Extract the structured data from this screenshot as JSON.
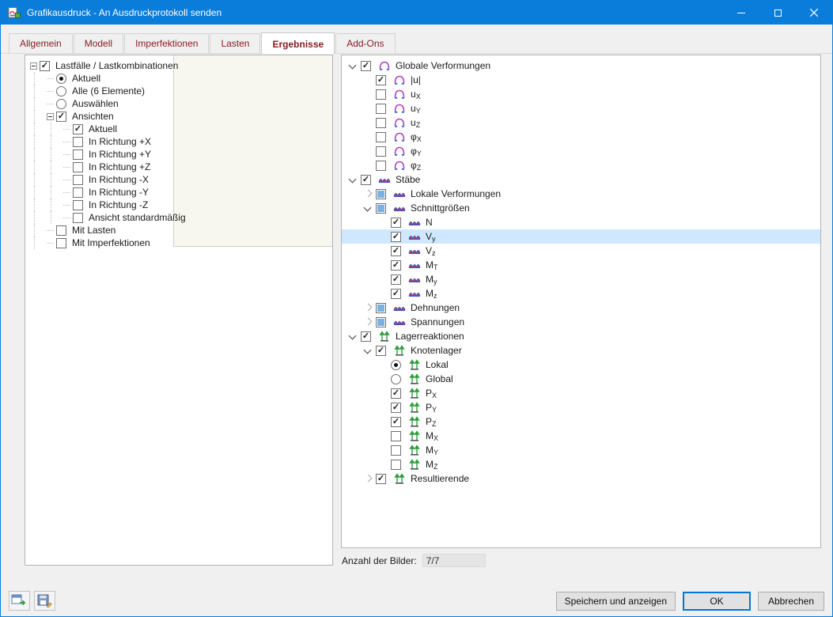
{
  "colors": {
    "titlebar": "#0a7cd9",
    "accent": "#0078d7",
    "selection": "#cfe8ff",
    "tab_text": "#8b1d22",
    "indeterminate": "#7ab1e3"
  },
  "window": {
    "title": "Grafikausdruck - An Ausdruckprotokoll senden"
  },
  "tabs": [
    {
      "label": "Allgemein",
      "selected": false
    },
    {
      "label": "Modell",
      "selected": false
    },
    {
      "label": "Imperfektionen",
      "selected": false
    },
    {
      "label": "Lasten",
      "selected": false
    },
    {
      "label": "Ergebnisse",
      "selected": true
    },
    {
      "label": "Add-Ons",
      "selected": false
    }
  ],
  "left_tree": [
    {
      "depth": 0,
      "expander": true,
      "control": "check",
      "state": "checked",
      "label": "Lastfälle / Lastkombinationen"
    },
    {
      "depth": 1,
      "expander": false,
      "control": "radio",
      "state": "selected",
      "label": "Aktuell"
    },
    {
      "depth": 1,
      "expander": false,
      "control": "radio",
      "state": "unselected",
      "label": "Alle (6 Elemente)"
    },
    {
      "depth": 1,
      "expander": false,
      "control": "radio",
      "state": "unselected",
      "label": "Auswählen"
    },
    {
      "depth": 1,
      "expander": true,
      "control": "check",
      "state": "checked",
      "label": "Ansichten"
    },
    {
      "depth": 2,
      "expander": false,
      "control": "check",
      "state": "checked",
      "label": "Aktuell"
    },
    {
      "depth": 2,
      "expander": false,
      "control": "check",
      "state": "unchecked",
      "label": "In Richtung +X"
    },
    {
      "depth": 2,
      "expander": false,
      "control": "check",
      "state": "unchecked",
      "label": "In Richtung +Y"
    },
    {
      "depth": 2,
      "expander": false,
      "control": "check",
      "state": "unchecked",
      "label": "In Richtung +Z"
    },
    {
      "depth": 2,
      "expander": false,
      "control": "check",
      "state": "unchecked",
      "label": "In Richtung -X"
    },
    {
      "depth": 2,
      "expander": false,
      "control": "check",
      "state": "unchecked",
      "label": "In Richtung -Y"
    },
    {
      "depth": 2,
      "expander": false,
      "control": "check",
      "state": "unchecked",
      "label": "In Richtung -Z"
    },
    {
      "depth": 2,
      "expander": false,
      "control": "check",
      "state": "unchecked",
      "label": "Ansicht standardmäßig"
    },
    {
      "depth": 1,
      "expander": false,
      "control": "check",
      "state": "unchecked",
      "label": "Mit Lasten"
    },
    {
      "depth": 1,
      "expander": false,
      "control": "check",
      "state": "unchecked",
      "label": "Mit Imperfektionen"
    }
  ],
  "right_tree": [
    {
      "depth": 0,
      "chevron": "down",
      "control": "check",
      "state": "checked",
      "icon": "dome",
      "label": "Globale Verformungen"
    },
    {
      "depth": 1,
      "chevron": null,
      "control": "check",
      "state": "checked",
      "icon": "dome",
      "label": "|u|"
    },
    {
      "depth": 1,
      "chevron": null,
      "control": "check",
      "state": "unchecked",
      "icon": "dome",
      "label": "u",
      "sub": "X"
    },
    {
      "depth": 1,
      "chevron": null,
      "control": "check",
      "state": "unchecked",
      "icon": "dome",
      "label": "u",
      "sub": "Y"
    },
    {
      "depth": 1,
      "chevron": null,
      "control": "check",
      "state": "unchecked",
      "icon": "dome",
      "label": "u",
      "sub": "Z"
    },
    {
      "depth": 1,
      "chevron": null,
      "control": "check",
      "state": "unchecked",
      "icon": "dome",
      "label": "φ",
      "sub": "X"
    },
    {
      "depth": 1,
      "chevron": null,
      "control": "check",
      "state": "unchecked",
      "icon": "dome",
      "label": "φ",
      "sub": "Y"
    },
    {
      "depth": 1,
      "chevron": null,
      "control": "check",
      "state": "unchecked",
      "icon": "dome",
      "label": "φ",
      "sub": "Z"
    },
    {
      "depth": 0,
      "chevron": "down",
      "control": "check",
      "state": "checked",
      "icon": "beam",
      "label": "Stäbe"
    },
    {
      "depth": 1,
      "chevron": "right",
      "control": "check",
      "state": "mixed",
      "icon": "beam",
      "label": "Lokale Verformungen"
    },
    {
      "depth": 1,
      "chevron": "down",
      "control": "check",
      "state": "mixed",
      "icon": "beam",
      "label": "Schnittgrößen"
    },
    {
      "depth": 2,
      "chevron": null,
      "control": "check",
      "state": "checked",
      "icon": "beam",
      "label": "N"
    },
    {
      "depth": 2,
      "chevron": null,
      "control": "check",
      "state": "checked",
      "icon": "beam",
      "label": "V",
      "sub": "y",
      "highlighted": true
    },
    {
      "depth": 2,
      "chevron": null,
      "control": "check",
      "state": "checked",
      "icon": "beam",
      "label": "V",
      "sub": "z"
    },
    {
      "depth": 2,
      "chevron": null,
      "control": "check",
      "state": "checked",
      "icon": "beam",
      "label": "M",
      "sub": "T"
    },
    {
      "depth": 2,
      "chevron": null,
      "control": "check",
      "state": "checked",
      "icon": "beam",
      "label": "M",
      "sub": "y"
    },
    {
      "depth": 2,
      "chevron": null,
      "control": "check",
      "state": "checked",
      "icon": "beam",
      "label": "M",
      "sub": "z"
    },
    {
      "depth": 1,
      "chevron": "right",
      "control": "check",
      "state": "mixed",
      "icon": "beam",
      "label": "Dehnungen"
    },
    {
      "depth": 1,
      "chevron": "right",
      "control": "check",
      "state": "mixed",
      "icon": "beam",
      "label": "Spannungen"
    },
    {
      "depth": 0,
      "chevron": "down",
      "control": "check",
      "state": "checked",
      "icon": "support",
      "label": "Lagerreaktionen"
    },
    {
      "depth": 1,
      "chevron": "down",
      "control": "check",
      "state": "checked",
      "icon": "support",
      "label": "Knotenlager"
    },
    {
      "depth": 2,
      "chevron": null,
      "control": "radio",
      "state": "selected",
      "icon": "support",
      "label": "Lokal"
    },
    {
      "depth": 2,
      "chevron": null,
      "control": "radio",
      "state": "unselected",
      "icon": "support",
      "label": "Global"
    },
    {
      "depth": 2,
      "chevron": null,
      "control": "check",
      "state": "checked",
      "icon": "support",
      "label": "P",
      "sub": "X"
    },
    {
      "depth": 2,
      "chevron": null,
      "control": "check",
      "state": "checked",
      "icon": "support",
      "label": "P",
      "sub": "Y"
    },
    {
      "depth": 2,
      "chevron": null,
      "control": "check",
      "state": "checked",
      "icon": "support",
      "label": "P",
      "sub": "Z"
    },
    {
      "depth": 2,
      "chevron": null,
      "control": "check",
      "state": "unchecked",
      "icon": "support",
      "label": "M",
      "sub": "X"
    },
    {
      "depth": 2,
      "chevron": null,
      "control": "check",
      "state": "unchecked",
      "icon": "support",
      "label": "M",
      "sub": "Y"
    },
    {
      "depth": 2,
      "chevron": null,
      "control": "check",
      "state": "unchecked",
      "icon": "support",
      "label": "M",
      "sub": "Z"
    },
    {
      "depth": 1,
      "chevron": "right",
      "control": "check",
      "state": "checked",
      "icon": "support",
      "label": "Resultierende"
    }
  ],
  "count": {
    "label": "Anzahl der Bilder:",
    "value": "7/7"
  },
  "footer": {
    "save_show": "Speichern und anzeigen",
    "ok": "OK",
    "cancel": "Abbrechen"
  }
}
